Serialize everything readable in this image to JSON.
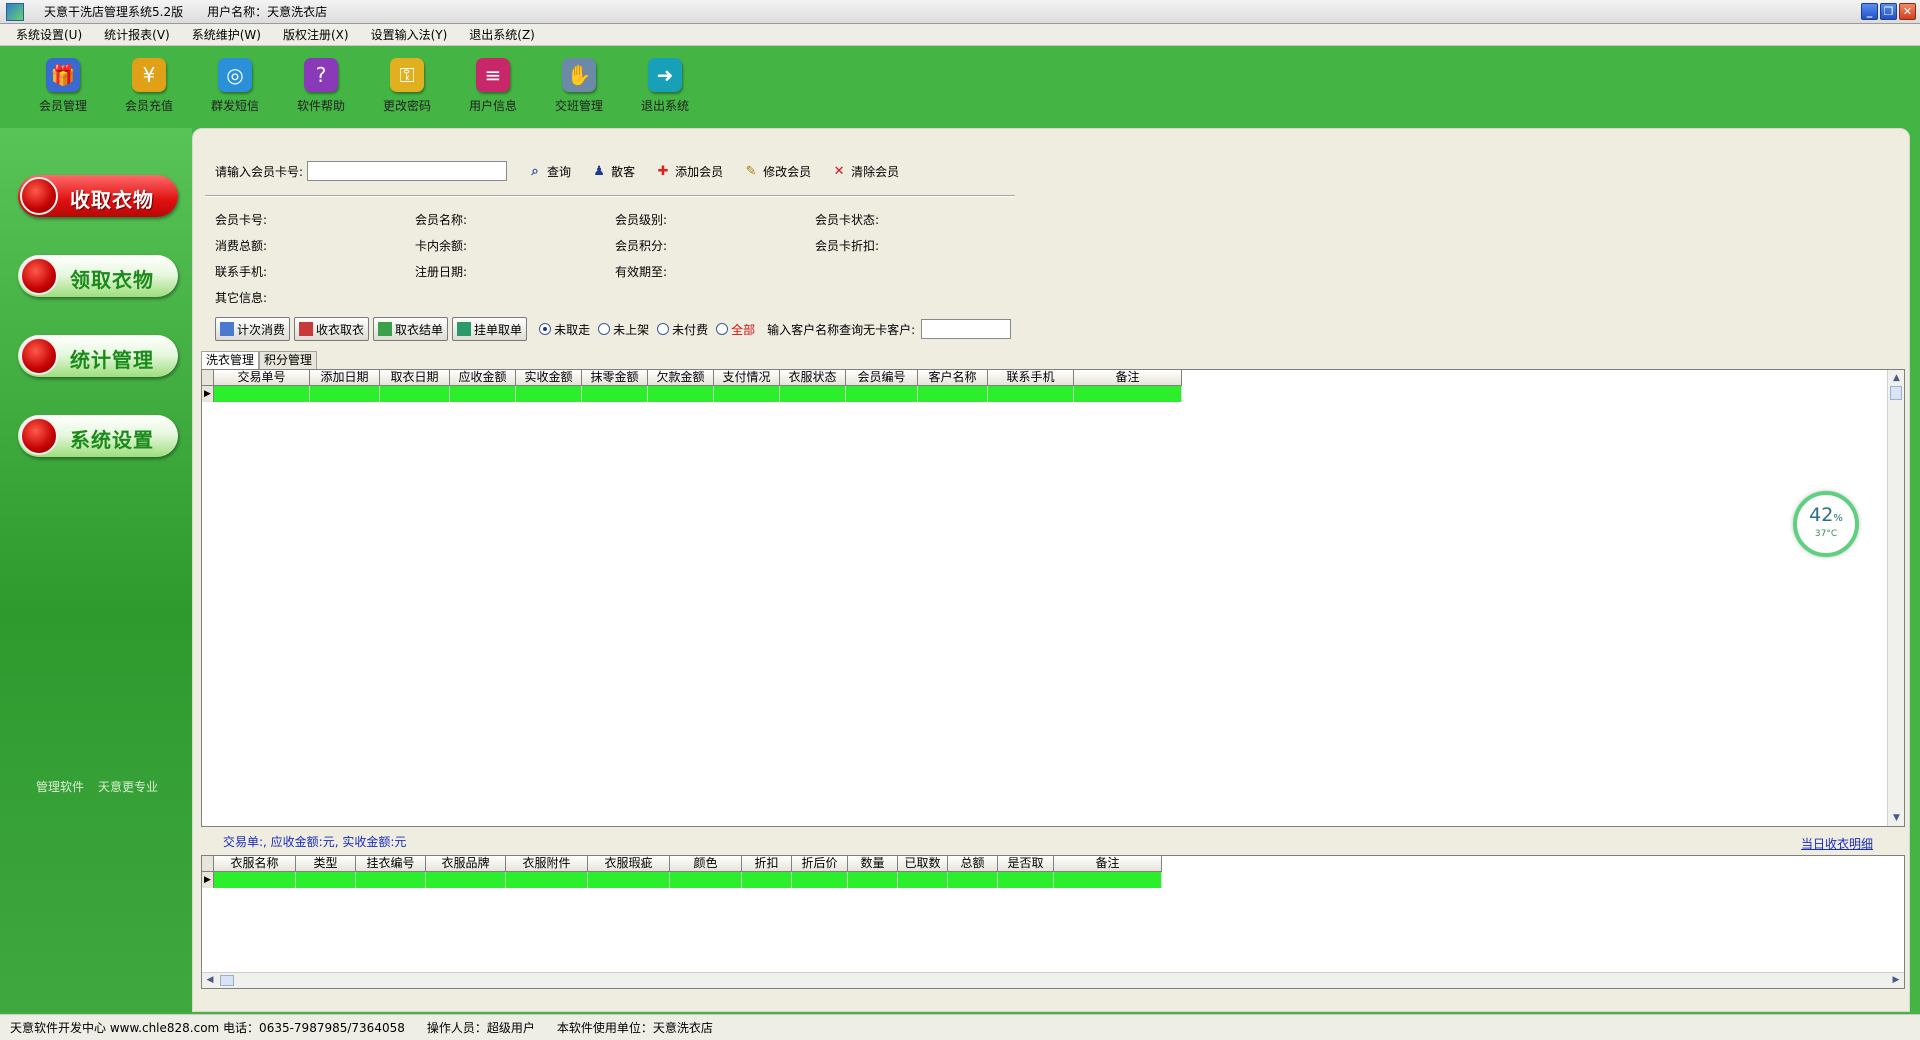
{
  "window": {
    "title": "天意干洗店管理系统5.2版",
    "user_label": "用户名称：天意洗衣店",
    "buttons": {
      "minimize": "_",
      "restore": "❐",
      "close": "✕"
    }
  },
  "menu": [
    "系统设置(U)",
    "统计报表(V)",
    "系统维护(W)",
    "版权注册(X)",
    "设置输入法(Y)",
    "退出系统(Z)"
  ],
  "toolbar": [
    {
      "label": "会员管理",
      "icon": "member-gift-icon",
      "color": "#3a6ad0"
    },
    {
      "label": "会员充值",
      "icon": "coins-icon",
      "color": "#e0a018"
    },
    {
      "label": "群发短信",
      "icon": "globe-sms-icon",
      "color": "#2a90d8"
    },
    {
      "label": "软件帮助",
      "icon": "help-book-icon",
      "color": "#8a3ab8"
    },
    {
      "label": "更改密码",
      "icon": "key-icon",
      "color": "#e0b020"
    },
    {
      "label": "用户信息",
      "icon": "books-icon",
      "color": "#c8286a"
    },
    {
      "label": "交班管理",
      "icon": "handshake-icon",
      "color": "#6a8aa8"
    },
    {
      "label": "退出系统",
      "icon": "exit-door-icon",
      "color": "#18a0b8"
    }
  ],
  "sidebar": {
    "items": [
      {
        "label": "收取衣物",
        "active": true
      },
      {
        "label": "领取衣物",
        "active": false
      },
      {
        "label": "统计管理",
        "active": false
      },
      {
        "label": "系统设置",
        "active": false
      }
    ],
    "footer_left": "管理软件",
    "footer_right": "天意更专业"
  },
  "search": {
    "label": "请输入会员卡号:",
    "value": "",
    "actions": [
      {
        "label": "查询",
        "icon": "search-icon"
      },
      {
        "label": "散客",
        "icon": "walk-in-icon"
      },
      {
        "label": "添加会员",
        "icon": "add-icon"
      },
      {
        "label": "修改会员",
        "icon": "edit-pencil-icon"
      },
      {
        "label": "清除会员",
        "icon": "clear-x-icon"
      }
    ]
  },
  "member_info": {
    "card_no": "会员卡号:",
    "name": "会员名称:",
    "level": "会员级别:",
    "card_status": "会员卡状态:",
    "total_spent": "消费总额:",
    "balance": "卡内余额:",
    "points": "会员积分:",
    "discount": "会员卡折扣:",
    "phone": "联系手机:",
    "reg_date": "注册日期:",
    "expiry": "有效期至:",
    "other": "其它信息:"
  },
  "filter": {
    "buttons": [
      "计次消费",
      "收衣取衣",
      "取衣结单",
      "挂单取单"
    ],
    "radios": [
      {
        "label": "未取走",
        "checked": true
      },
      {
        "label": "未上架",
        "checked": false
      },
      {
        "label": "未付费",
        "checked": false
      },
      {
        "label": "全部",
        "checked": false
      }
    ],
    "query_label": "输入客户名称查询无卡客户:",
    "query_value": ""
  },
  "tabs": [
    {
      "label": "洗衣管理",
      "active": true
    },
    {
      "label": "积分管理",
      "active": false
    }
  ],
  "grid1": {
    "columns": [
      "交易单号",
      "添加日期",
      "取衣日期",
      "应收金额",
      "实收金额",
      "抹零金额",
      "欠款金额",
      "支付情况",
      "衣服状态",
      "会员编号",
      "客户名称",
      "联系手机",
      "备注"
    ],
    "row_marker": "▶"
  },
  "gauge": {
    "percent": "42",
    "percent_unit": "%",
    "temp": "37°C"
  },
  "summary": {
    "text": "交易单:, 应收金额:元, 实收金额:元",
    "daily_link": "当日收衣明细"
  },
  "grid2": {
    "columns": [
      "衣服名称",
      "类型",
      "挂衣编号",
      "衣服品牌",
      "衣服附件",
      "衣服瑕疵",
      "颜色",
      "折扣",
      "折后价",
      "数量",
      "已取数",
      "总额",
      "是否取",
      "备注"
    ],
    "row_marker": "▶"
  },
  "statusbar": {
    "developer": "天意软件开发中心 www.chle828.com 电话：0635-7987985/7364058",
    "operator": "操作人员：超级用户",
    "unit": "本软件使用单位：天意洗衣店"
  }
}
